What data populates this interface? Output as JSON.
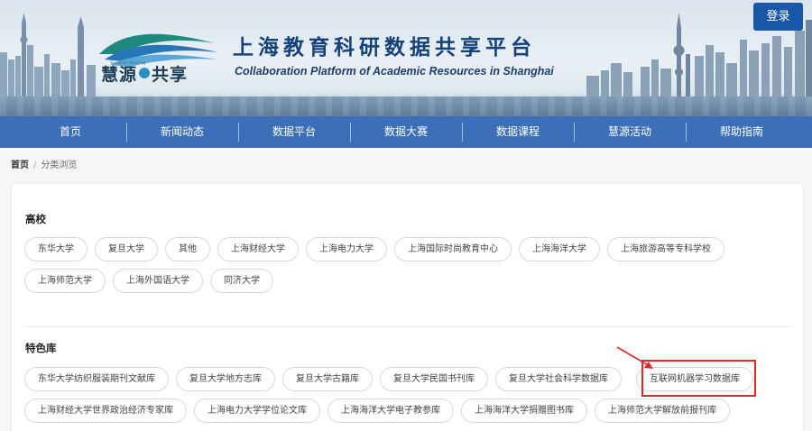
{
  "header": {
    "title": "上海教育科研数据共享平台",
    "subtitle": "Collaboration Platform of Academic Resources in Shanghai",
    "logo_small_text": "Huiyuan Sharing",
    "logo_brand_left": "慧源",
    "logo_brand_right": "共享",
    "login_label": "登录"
  },
  "nav": {
    "items": [
      "首页",
      "新闻动态",
      "数据平台",
      "数据大赛",
      "数据课程",
      "慧源活动",
      "帮助指南"
    ]
  },
  "breadcrumb": {
    "home": "首页",
    "separator": "/",
    "current": "分类浏览"
  },
  "sections": [
    {
      "title": "高校",
      "tags": [
        "东华大学",
        "复旦大学",
        "其他",
        "上海财经大学",
        "上海电力大学",
        "上海国际时尚教育中心",
        "上海海洋大学",
        "上海旅游高等专科学校",
        "上海师范大学",
        "上海外国语大学",
        "同济大学"
      ]
    },
    {
      "title": "特色库",
      "tags": [
        "东华大学纺织服装期刊文献库",
        "复旦大学地方志库",
        "复旦大学古籍库",
        "复旦大学民国书刊库",
        "复旦大学社会科学数据库",
        "互联网机器学习数据库",
        "上海财经大学世界政治经济专家库",
        "上海电力大学学位论文库",
        "上海海洋大学电子教参库",
        "上海海洋大学捐赠图书库",
        "上海师范大学解放前报刊库"
      ]
    }
  ],
  "colors": {
    "nav_bg": "#3b6fb8",
    "login_bg": "#1b57a8",
    "title_color": "#16427a",
    "highlight": "#e02a2a"
  }
}
